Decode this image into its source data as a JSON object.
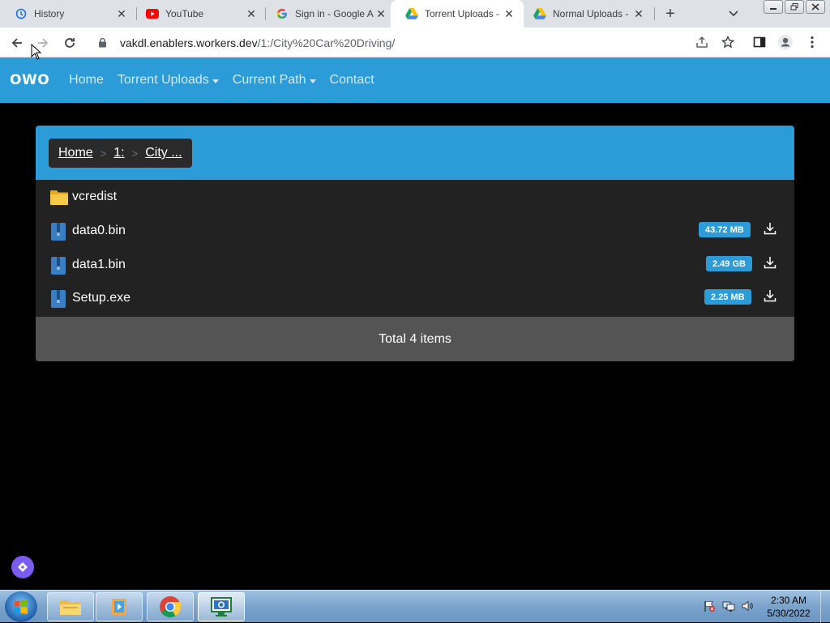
{
  "browser": {
    "tabs": [
      {
        "title": "History",
        "icon": "history-icon"
      },
      {
        "title": "YouTube",
        "icon": "youtube-icon"
      },
      {
        "title": "Sign in - Google A",
        "icon": "google-icon"
      },
      {
        "title": "Torrent Uploads -",
        "icon": "google-drive-icon"
      },
      {
        "title": "Normal Uploads -",
        "icon": "google-drive-icon"
      }
    ],
    "active_tab": 3,
    "url": {
      "host": "vakdl.enablers.workers.dev",
      "path": "/1:/City%20Car%20Driving/"
    }
  },
  "site": {
    "brand": "OWO",
    "nav": {
      "home": "Home",
      "torrent_uploads": "Torrent Uploads",
      "current_path": "Current Path",
      "contact": "Contact"
    },
    "breadcrumb": [
      "Home",
      "1:",
      "City ..."
    ],
    "breadcrumb_sep": ">",
    "items": [
      {
        "name": "vcredist",
        "type": "folder",
        "size": ""
      },
      {
        "name": "data0.bin",
        "type": "file",
        "size": "43.72 MB"
      },
      {
        "name": "data1.bin",
        "type": "file",
        "size": "2.49 GB"
      },
      {
        "name": "Setup.exe",
        "type": "file",
        "size": "2.25 MB"
      }
    ],
    "total": "Total 4 items"
  },
  "taskbar": {
    "time": "2:30 AM",
    "date": "5/30/2022"
  },
  "colors": {
    "accent": "#2b9cd8",
    "list_bg": "#222222",
    "footer_bg": "#545454",
    "folder": "#f7c948",
    "file": "#3a7fc4"
  }
}
